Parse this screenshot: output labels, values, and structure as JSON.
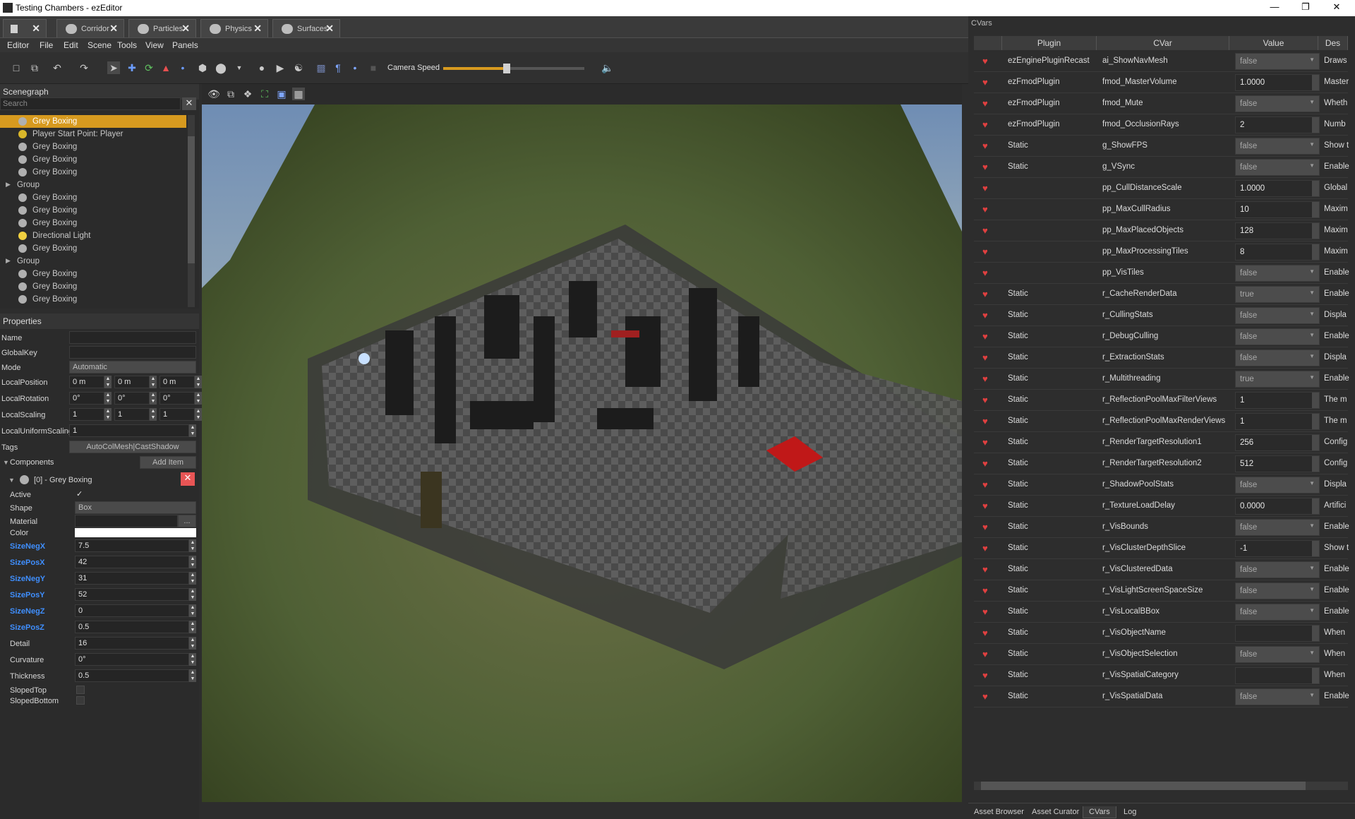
{
  "window": {
    "title": "Testing Chambers - ezEditor"
  },
  "doc_tabs": [
    {
      "label": "Corridor"
    },
    {
      "label": "Particles"
    },
    {
      "label": "Physics"
    },
    {
      "label": "Surfaces"
    }
  ],
  "menu": [
    "Editor",
    "File",
    "Edit",
    "Scene",
    "Tools",
    "View",
    "Panels"
  ],
  "toolbar": {
    "camera_speed_label": "Camera Speed",
    "camera_speed_level": 0.45
  },
  "scenegraph": {
    "title": "Scenegraph",
    "search_placeholder": "Search",
    "items": [
      {
        "label": "Grey Boxing",
        "selected": true
      },
      {
        "label": "Player Start Point: Player"
      },
      {
        "label": "Grey Boxing"
      },
      {
        "label": "Grey Boxing"
      },
      {
        "label": "Grey Boxing"
      },
      {
        "label": "Group",
        "group": true
      },
      {
        "label": "Grey Boxing"
      },
      {
        "label": "Grey Boxing"
      },
      {
        "label": "Grey Boxing"
      },
      {
        "label": "Directional Light"
      },
      {
        "label": "Grey Boxing"
      },
      {
        "label": "Group",
        "group": true
      },
      {
        "label": "Grey Boxing"
      },
      {
        "label": "Grey Boxing"
      },
      {
        "label": "Grey Boxing"
      }
    ]
  },
  "properties": {
    "title": "Properties",
    "name_label": "Name",
    "globalkey_label": "GlobalKey",
    "mode_label": "Mode",
    "mode_value": "Automatic",
    "localposition_label": "LocalPosition",
    "localposition": [
      "0 m",
      "0 m",
      "0 m"
    ],
    "localrotation_label": "LocalRotation",
    "localrotation": [
      "0°",
      "0°",
      "0°"
    ],
    "localscaling_label": "LocalScaling",
    "localscaling": [
      "1",
      "1",
      "1"
    ],
    "localuniformscaling_label": "LocalUniformScaling",
    "localuniformscaling": "1",
    "tags_label": "Tags",
    "tags_value": "AutoColMesh|CastShadow",
    "components_label": "Components",
    "add_item_label": "Add Item",
    "component_title": "[0] - Grey Boxing",
    "active_label": "Active",
    "active_check": "✓",
    "shape_label": "Shape",
    "shape_value": "Box",
    "material_label": "Material",
    "material_browse": "...",
    "color_label": "Color",
    "fields": [
      {
        "label": "SizeNegX",
        "value": "7.5",
        "blue": true
      },
      {
        "label": "SizePosX",
        "value": "42",
        "blue": true
      },
      {
        "label": "SizeNegY",
        "value": "31",
        "blue": true
      },
      {
        "label": "SizePosY",
        "value": "52",
        "blue": true
      },
      {
        "label": "SizeNegZ",
        "value": "0",
        "blue": true
      },
      {
        "label": "SizePosZ",
        "value": "0.5",
        "blue": true
      },
      {
        "label": "Detail",
        "value": "16",
        "blue": false
      },
      {
        "label": "Curvature",
        "value": "0°",
        "blue": false
      },
      {
        "label": "Thickness",
        "value": "0.5",
        "blue": false
      }
    ],
    "slopedtop_label": "SlopedTop",
    "slopedbottom_label": "SlopedBottom"
  },
  "cvars": {
    "title": "CVars",
    "columns": [
      "Plugin",
      "CVar",
      "Value",
      "Des"
    ],
    "rows": [
      {
        "plugin": "ezEnginePluginRecast",
        "name": "ai_ShowNavMesh",
        "value": "false",
        "combo": true,
        "desc": "Draws"
      },
      {
        "plugin": "ezFmodPlugin",
        "name": "fmod_MasterVolume",
        "value": "1.0000",
        "combo": false,
        "desc": "Master"
      },
      {
        "plugin": "ezFmodPlugin",
        "name": "fmod_Mute",
        "value": "false",
        "combo": true,
        "desc": "Wheth"
      },
      {
        "plugin": "ezFmodPlugin",
        "name": "fmod_OcclusionRays",
        "value": "2",
        "combo": false,
        "desc": "Numb"
      },
      {
        "plugin": "Static",
        "name": "g_ShowFPS",
        "value": "false",
        "combo": true,
        "desc": "Show t"
      },
      {
        "plugin": "Static",
        "name": "g_VSync",
        "value": "false",
        "combo": true,
        "desc": "Enable"
      },
      {
        "plugin": "",
        "name": "pp_CullDistanceScale",
        "value": "1.0000",
        "combo": false,
        "desc": "Global"
      },
      {
        "plugin": "",
        "name": "pp_MaxCullRadius",
        "value": "10",
        "combo": false,
        "desc": "Maxim"
      },
      {
        "plugin": "",
        "name": "pp_MaxPlacedObjects",
        "value": "128",
        "combo": false,
        "desc": "Maxim"
      },
      {
        "plugin": "",
        "name": "pp_MaxProcessingTiles",
        "value": "8",
        "combo": false,
        "desc": "Maxim"
      },
      {
        "plugin": "",
        "name": "pp_VisTiles",
        "value": "false",
        "combo": true,
        "desc": "Enable"
      },
      {
        "plugin": "Static",
        "name": "r_CacheRenderData",
        "value": "true",
        "combo": true,
        "desc": "Enable"
      },
      {
        "plugin": "Static",
        "name": "r_CullingStats",
        "value": "false",
        "combo": true,
        "desc": "Displa"
      },
      {
        "plugin": "Static",
        "name": "r_DebugCulling",
        "value": "false",
        "combo": true,
        "desc": "Enable"
      },
      {
        "plugin": "Static",
        "name": "r_ExtractionStats",
        "value": "false",
        "combo": true,
        "desc": "Displa"
      },
      {
        "plugin": "Static",
        "name": "r_Multithreading",
        "value": "true",
        "combo": true,
        "desc": "Enable"
      },
      {
        "plugin": "Static",
        "name": "r_ReflectionPoolMaxFilterViews",
        "value": "1",
        "combo": false,
        "desc": "The m"
      },
      {
        "plugin": "Static",
        "name": "r_ReflectionPoolMaxRenderViews",
        "value": "1",
        "combo": false,
        "desc": "The m"
      },
      {
        "plugin": "Static",
        "name": "r_RenderTargetResolution1",
        "value": "256",
        "combo": false,
        "desc": "Config"
      },
      {
        "plugin": "Static",
        "name": "r_RenderTargetResolution2",
        "value": "512",
        "combo": false,
        "desc": "Config"
      },
      {
        "plugin": "Static",
        "name": "r_ShadowPoolStats",
        "value": "false",
        "combo": true,
        "desc": "Displa"
      },
      {
        "plugin": "Static",
        "name": "r_TextureLoadDelay",
        "value": "0.0000",
        "combo": false,
        "desc": "Artifici"
      },
      {
        "plugin": "Static",
        "name": "r_VisBounds",
        "value": "false",
        "combo": true,
        "desc": "Enable"
      },
      {
        "plugin": "Static",
        "name": "r_VisClusterDepthSlice",
        "value": "-1",
        "combo": false,
        "desc": "Show t"
      },
      {
        "plugin": "Static",
        "name": "r_VisClusteredData",
        "value": "false",
        "combo": true,
        "desc": "Enable"
      },
      {
        "plugin": "Static",
        "name": "r_VisLightScreenSpaceSize",
        "value": "false",
        "combo": true,
        "desc": "Enable"
      },
      {
        "plugin": "Static",
        "name": "r_VisLocalBBox",
        "value": "false",
        "combo": true,
        "desc": "Enable"
      },
      {
        "plugin": "Static",
        "name": "r_VisObjectName",
        "value": "",
        "combo": false,
        "desc": "When"
      },
      {
        "plugin": "Static",
        "name": "r_VisObjectSelection",
        "value": "false",
        "combo": true,
        "desc": "When"
      },
      {
        "plugin": "Static",
        "name": "r_VisSpatialCategory",
        "value": "",
        "combo": false,
        "desc": "When"
      },
      {
        "plugin": "Static",
        "name": "r_VisSpatialData",
        "value": "false",
        "combo": true,
        "desc": "Enable"
      }
    ]
  },
  "bottom_tabs": [
    {
      "label": "Asset Browser",
      "active": false
    },
    {
      "label": "Asset Curator",
      "active": false
    },
    {
      "label": "CVars",
      "active": true
    },
    {
      "label": "Log",
      "active": false
    }
  ],
  "colors": {
    "selection": "#d79a1f",
    "accent_blue": "#3f8fff",
    "heart": "#e04040"
  }
}
